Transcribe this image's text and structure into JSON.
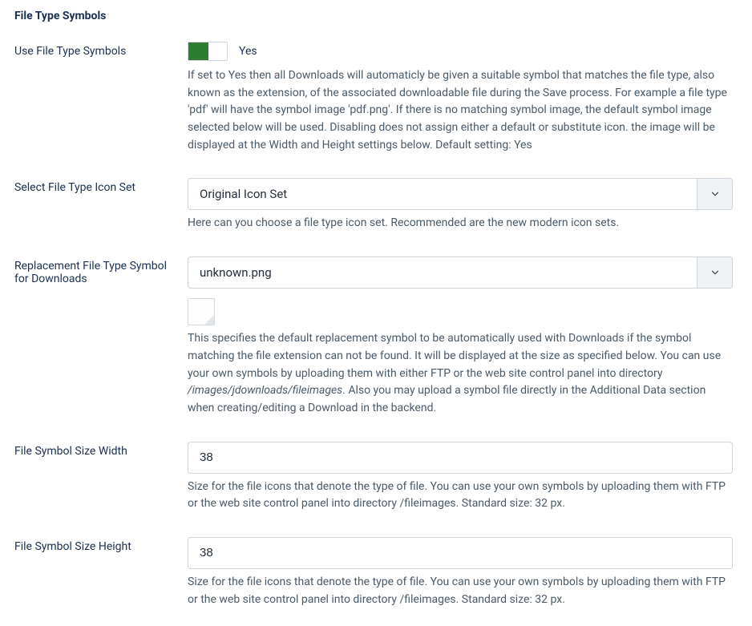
{
  "section": {
    "title": "File Type Symbols"
  },
  "useSymbols": {
    "label": "Use File Type Symbols",
    "state": "Yes",
    "help": "If set to Yes then all Downloads will automaticly be given a suitable symbol that matches the file type, also known as the extension, of the associated downloadable file during the Save process. For example a file type 'pdf' will have the symbol image 'pdf.png'. If there is no matching symbol image, the default symbol image selected below will be used. Disabling does not assign either a default or substitute icon. the image will be displayed at the Width and Height settings below. Default setting: Yes"
  },
  "iconSet": {
    "label": "Select File Type Icon Set",
    "value": "Original Icon Set",
    "help": "Here can you choose a file type icon set. Recommended are the new modern icon sets."
  },
  "replacementSymbol": {
    "label": "Replacement File Type Symbol for Downloads",
    "value": "unknown.png",
    "help_pre": "This specifies the default replacement symbol to be automatically used with Downloads if the symbol matching the file extension can not be found. It will be displayed at the size as specified below. You can use your own symbols by uploading them with either FTP or the web site control panel into directory ",
    "help_path": "/images/jdownloads/fileimages",
    "help_post": ". Also you may upload a symbol file directly in the Additional Data section when creating/editing a Download in the backend."
  },
  "width": {
    "label": "File Symbol Size Width",
    "value": "38",
    "help": "Size for the file icons that denote the type of file. You can use your own symbols by uploading them with FTP or the web site control panel into directory /fileimages. Standard size: 32 px."
  },
  "height": {
    "label": "File Symbol Size Height",
    "value": "38",
    "help": "Size for the file icons that denote the type of file. You can use your own symbols by uploading them with FTP or the web site control panel into directory /fileimages. Standard size: 32 px."
  }
}
